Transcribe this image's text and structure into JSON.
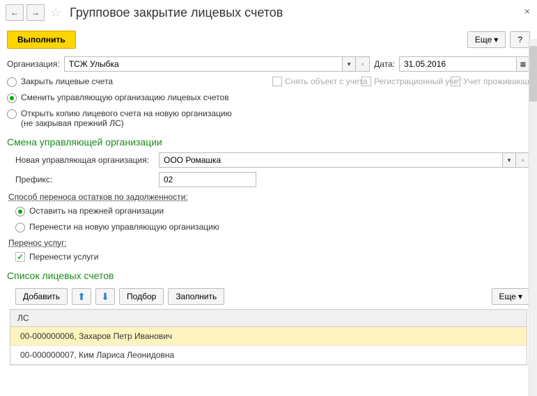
{
  "header": {
    "title": "Групповое закрытие лицевых счетов"
  },
  "toolbar": {
    "execute": "Выполнить",
    "more": "Еще",
    "help": "?"
  },
  "org": {
    "label": "Организация:",
    "value": "ТСЖ Улыбка",
    "date_label": "Дата:",
    "date_value": "31.05.2016"
  },
  "modes": {
    "close": "Закрыть лицевые счета",
    "change": "Сменить управляющую организацию лицевых счетов",
    "copy_line1": "Открыть копию лицевого счета на новую организацию",
    "copy_line2": "(не закрывая прежний ЛС)"
  },
  "chk": {
    "remove": "Снять объект с учета",
    "reg": "Регистрационный учет",
    "resid": "Учет проживающих"
  },
  "section1": {
    "title": "Смена управляющей организации",
    "new_org_label": "Новая управляющая организация:",
    "new_org_value": "ООО Ромашка",
    "prefix_label": "Префикс:",
    "prefix_value": "02",
    "debt_method_label": "Способ переноса остатков по задолженности:",
    "debt_keep": "Оставить на прежней организации",
    "debt_move": "Перенести на новую управляющую организацию",
    "svc_label": "Перенос услуг:",
    "svc_move": "Перенести услуги"
  },
  "section2": {
    "title": "Список лицевых счетов",
    "add": "Добавить",
    "pick": "Подбор",
    "fill": "Заполнить",
    "more": "Еще",
    "col_ls": "ЛС",
    "rows": [
      "00-000000006, Захаров Петр Иванович",
      "00-000000007, Ким Лариса Леонидовна"
    ]
  }
}
